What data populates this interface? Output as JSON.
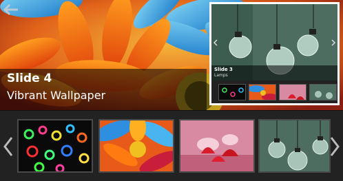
{
  "main_slide": {
    "title": "Slide 4",
    "subtitle": "Vibrant Wallpaper"
  },
  "inset": {
    "title": "Slide 3",
    "subtitle": "Lamps"
  },
  "thumbnails": [
    {
      "name": "neon-rings",
      "bg": "#0a0a0a"
    },
    {
      "name": "colorful-flower",
      "bg": "#e85a1a"
    },
    {
      "name": "strawberry-splash",
      "bg": "#d88aa2"
    },
    {
      "name": "lamps",
      "bg": "#4d6d60"
    }
  ],
  "icons": {
    "prev": "chevron-left-icon",
    "next": "chevron-right-icon"
  },
  "colors": {
    "strip_bg": "#222222",
    "caption_text": "#ffffff",
    "thumb_border": "#4a4a4a"
  }
}
